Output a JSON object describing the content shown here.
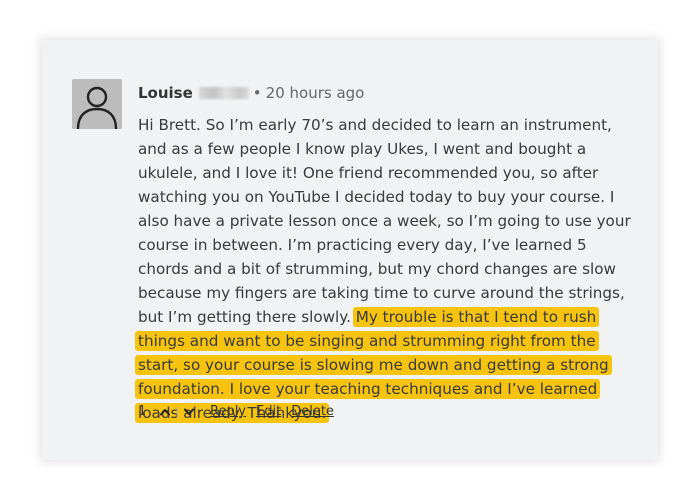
{
  "comment": {
    "author": "Louise",
    "separator": "•",
    "timestamp": "20 hours ago",
    "text_plain": "Hi Brett. So I’m early 70’s and decided to learn an instrument, and as a few people I know play Ukes, I went and bought a ukulele, and I love it! One friend recommended you, so after watching you on YouTube I decided today to buy your course. I also have a private lesson once a week, so I’m going to use your course in between. I’m practicing every day, I’ve learned 5 chords and a bit of strumming, but my chord changes are slow because my fingers are taking time to curve around the strings, but I’m getting there slowly. ",
    "text_highlighted": "My trouble is that I tend to rush things and want to be singing and strumming right from the start, so your course is slowing me down and getting a strong foundation. I love your teaching techniques and I’ve learned loads already. Thankyou.",
    "highlight_color": "#f6c40f"
  },
  "actions": {
    "vote_count": "1",
    "upvote_icon": "chevron-up-icon",
    "downvote_icon": "chevron-down-icon",
    "divider": "|",
    "reply_label": "Reply",
    "edit_label": "Edit",
    "delete_label": "Delete"
  },
  "avatar": {
    "icon": "user-icon"
  }
}
